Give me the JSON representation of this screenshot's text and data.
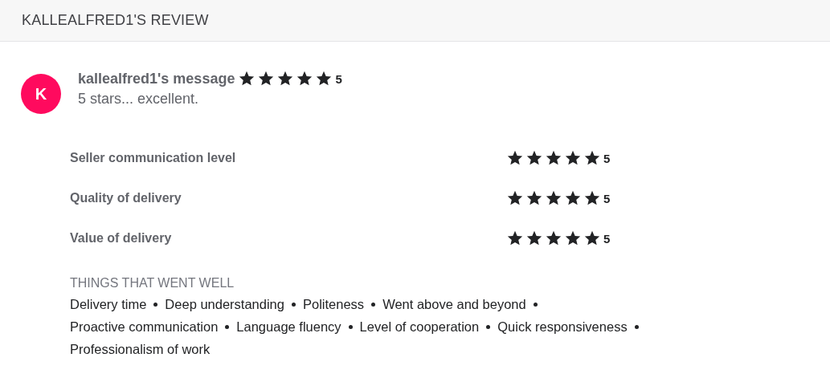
{
  "header": {
    "title": "KALLEALFRED1'S REVIEW"
  },
  "review": {
    "avatar_letter": "K",
    "author": "kallealfred1's message",
    "stars": 5,
    "score": "5",
    "message": "5 stars... excellent."
  },
  "ratings": [
    {
      "label": "Seller communication level",
      "stars": 5,
      "score": "5"
    },
    {
      "label": "Quality of delivery",
      "stars": 5,
      "score": "5"
    },
    {
      "label": "Value of delivery",
      "stars": 5,
      "score": "5"
    }
  ],
  "highlights": {
    "title": "THINGS THAT WENT WELL",
    "items": [
      "Delivery time",
      "Deep understanding",
      "Politeness",
      "Went above and beyond",
      "Proactive communication",
      "Language fluency",
      "Level of cooperation",
      "Quick responsiveness",
      "Professionalism of work"
    ]
  }
}
